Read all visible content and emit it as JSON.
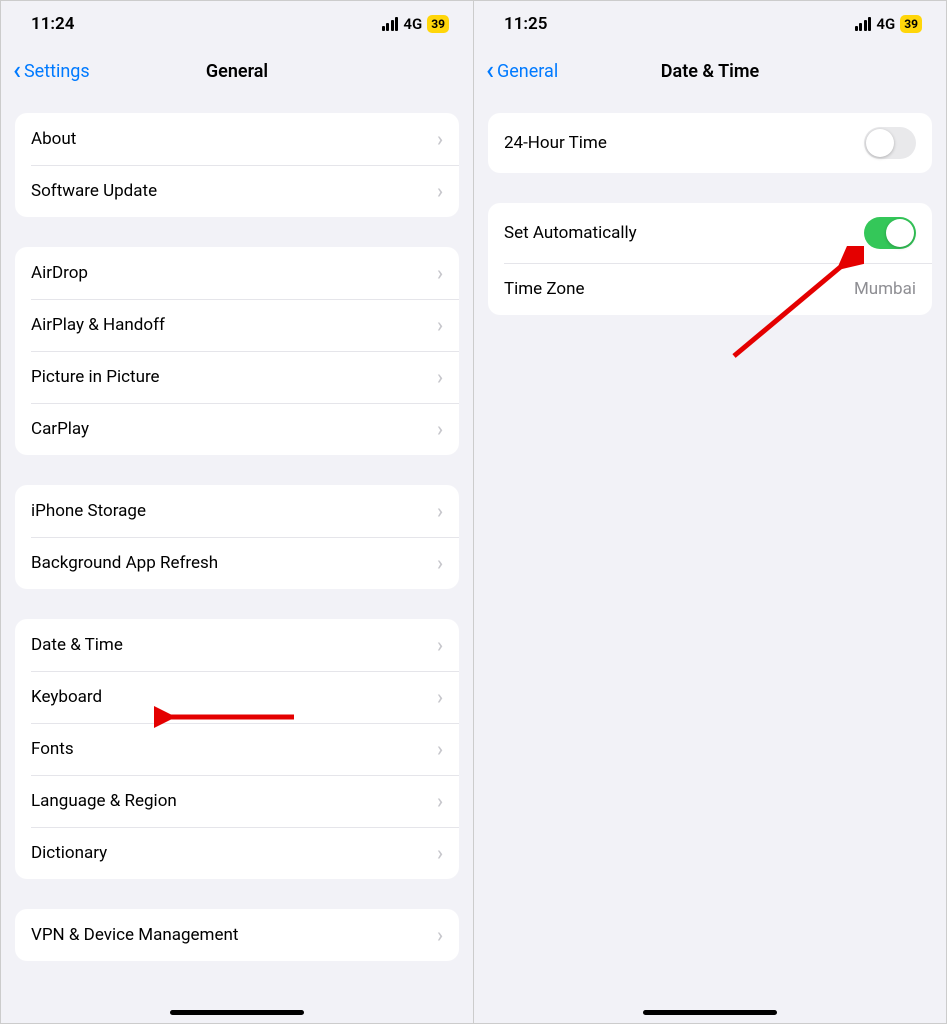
{
  "left": {
    "status": {
      "time": "11:24",
      "network": "4G",
      "battery": "39"
    },
    "nav": {
      "back": "Settings",
      "title": "General"
    },
    "groups": [
      {
        "rows": [
          {
            "label": "About"
          },
          {
            "label": "Software Update"
          }
        ]
      },
      {
        "rows": [
          {
            "label": "AirDrop"
          },
          {
            "label": "AirPlay & Handoff"
          },
          {
            "label": "Picture in Picture"
          },
          {
            "label": "CarPlay"
          }
        ]
      },
      {
        "rows": [
          {
            "label": "iPhone Storage"
          },
          {
            "label": "Background App Refresh"
          }
        ]
      },
      {
        "rows": [
          {
            "label": "Date & Time"
          },
          {
            "label": "Keyboard"
          },
          {
            "label": "Fonts"
          },
          {
            "label": "Language & Region"
          },
          {
            "label": "Dictionary"
          }
        ]
      },
      {
        "rows": [
          {
            "label": "VPN & Device Management"
          }
        ]
      }
    ]
  },
  "right": {
    "status": {
      "time": "11:25",
      "network": "4G",
      "battery": "39"
    },
    "nav": {
      "back": "General",
      "title": "Date & Time"
    },
    "groups": [
      {
        "rows": [
          {
            "label": "24-Hour Time",
            "toggle": "off"
          }
        ]
      },
      {
        "rows": [
          {
            "label": "Set Automatically",
            "toggle": "on"
          },
          {
            "label": "Time Zone",
            "value": "Mumbai"
          }
        ]
      }
    ]
  }
}
